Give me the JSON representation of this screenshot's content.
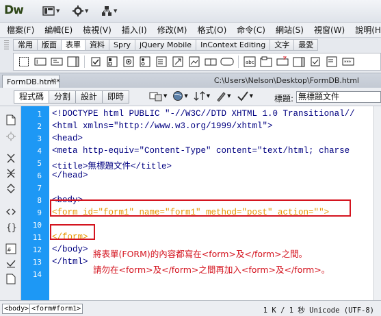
{
  "app": {
    "logo": "Dw"
  },
  "menu": [
    "檔案(F)",
    "編輯(E)",
    "檢視(V)",
    "插入(I)",
    "修改(M)",
    "格式(O)",
    "命令(C)",
    "網站(S)",
    "視窗(W)",
    "說明(H)"
  ],
  "insert_tabs": [
    "常用",
    "版面",
    "表單",
    "資料",
    "Spry",
    "jQuery Mobile",
    "InContext Editing",
    "文字",
    "最愛"
  ],
  "insert_active_tab": "表單",
  "document": {
    "tab_name": "FormDB.html*",
    "path": "C:\\Users\\Nelson\\Desktop\\FormDB.html"
  },
  "view_buttons": [
    "程式碼",
    "分割",
    "設計",
    "即時"
  ],
  "title_label": "標題:",
  "title_value": "無標題文件",
  "code_lines": [
    "<!DOCTYPE html PUBLIC \"-//W3C//DTD XHTML 1.0 Transitional//",
    "<html xmlns=\"http://www.w3.org/1999/xhtml\">",
    "<head>",
    "<meta http-equiv=\"Content-Type\" content=\"text/html; charse",
    "<title>無標題文件</title>",
    "</head>",
    "",
    "<body>",
    "<form id=\"form1\" name=\"form1\" method=\"post\" action=\"\">",
    "",
    "</form>",
    "</body>",
    "</html>",
    ""
  ],
  "line_numbers": [
    "1",
    "2",
    "3",
    "4",
    "5",
    "6",
    "7",
    "8",
    "9",
    "10",
    "11",
    "12",
    "13",
    "14"
  ],
  "annotations": {
    "line1": "將表單(FORM)的內容都寫在<form>及</form>之間。",
    "line2": "請勿在<form>及</form>之間再加入<form>及</form>。"
  },
  "status": {
    "crumbs": [
      "<body>",
      "<form#form1>"
    ],
    "info": "1 K / 1 秒  Unicode (UTF-8)"
  },
  "colors": {
    "accent": "#d4141f",
    "gutter": "#1d98f5",
    "form_tag": "#e69500"
  }
}
